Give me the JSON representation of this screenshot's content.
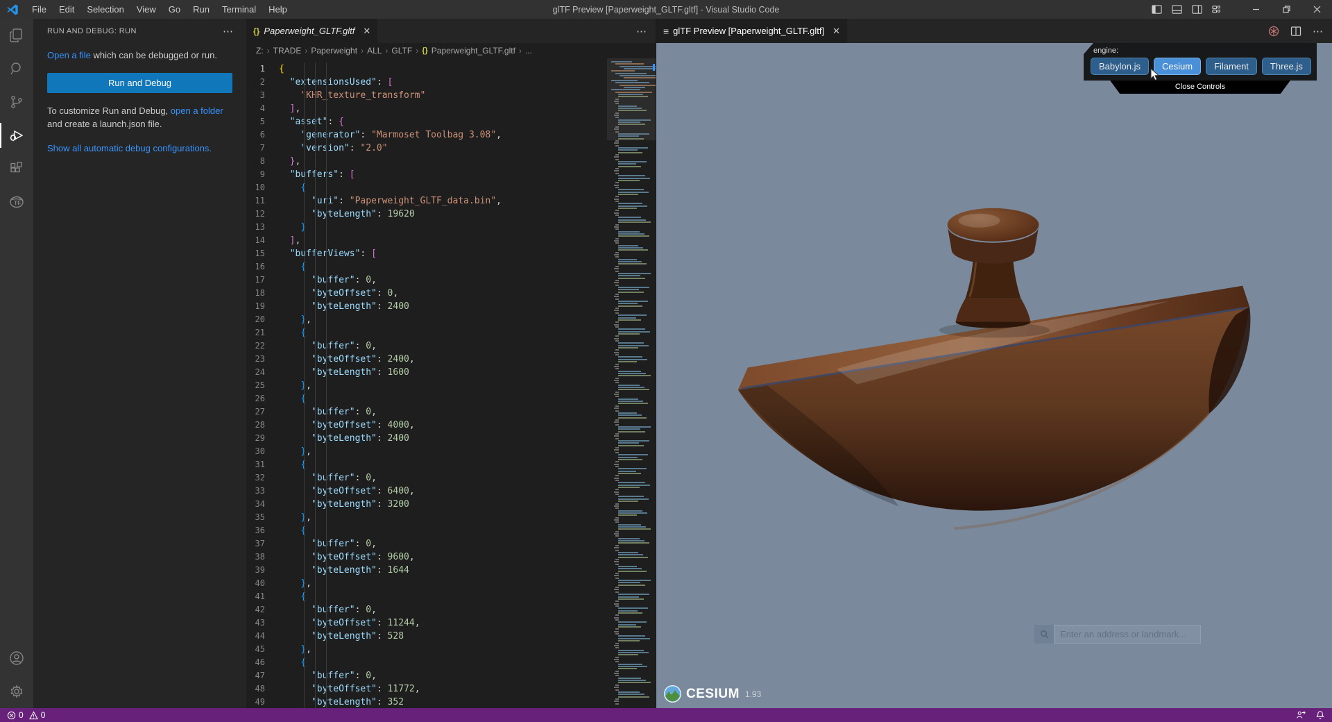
{
  "title_bar": {
    "title": "glTF Preview [Paperweight_GLTF.gltf] - Visual Studio Code",
    "menus": [
      "File",
      "Edit",
      "Selection",
      "View",
      "Go",
      "Run",
      "Terminal",
      "Help"
    ]
  },
  "activity_bar": {
    "items": [
      "explorer",
      "search",
      "source-control",
      "run-and-debug",
      "extensions",
      "gltf-tools"
    ],
    "active_item": "run-and-debug",
    "bottom_items": [
      "accounts",
      "settings"
    ]
  },
  "sidebar": {
    "header": "RUN AND DEBUG: RUN",
    "open_file": {
      "link": "Open a file",
      "rest": " which can be debugged or run."
    },
    "run_button": "Run and Debug",
    "customize": {
      "pre": "To customize Run and Debug, ",
      "link": "open a folder",
      "post": " and create a launch.json file."
    },
    "configs_link": "Show all automatic debug configurations."
  },
  "editor": {
    "tab_label": "Paperweight_GLTF.gltf",
    "breadcrumb": [
      "Z:",
      "TRADE",
      "Paperweight",
      "ALL",
      "GLTF",
      "Paperweight_GLTF.gltf",
      "..."
    ],
    "token_colors": {
      "k": "#9cdcfe",
      "s": "#ce9178",
      "n": "#b5cea8",
      "p": "#d4d4d4",
      "b1": "#ffd700",
      "b2": "#da70d6",
      "b3": "#179fff"
    },
    "lines": [
      [
        [
          "{",
          "b1"
        ]
      ],
      [
        [
          "  ",
          "p"
        ],
        [
          "\"extensionsUsed\"",
          "k"
        ],
        [
          ": ",
          "p"
        ],
        [
          "[",
          "b2"
        ]
      ],
      [
        [
          "    ",
          "p"
        ],
        [
          "\"KHR_texture_transform\"",
          "s"
        ]
      ],
      [
        [
          "  ",
          "p"
        ],
        [
          "]",
          "b2"
        ],
        [
          ",",
          "p"
        ]
      ],
      [
        [
          "  ",
          "p"
        ],
        [
          "\"asset\"",
          "k"
        ],
        [
          ": ",
          "p"
        ],
        [
          "{",
          "b2"
        ]
      ],
      [
        [
          "    ",
          "p"
        ],
        [
          "\"generator\"",
          "k"
        ],
        [
          ": ",
          "p"
        ],
        [
          "\"Marmoset Toolbag 3.08\"",
          "s"
        ],
        [
          ",",
          "p"
        ]
      ],
      [
        [
          "    ",
          "p"
        ],
        [
          "\"version\"",
          "k"
        ],
        [
          ": ",
          "p"
        ],
        [
          "\"2.0\"",
          "s"
        ]
      ],
      [
        [
          "  ",
          "p"
        ],
        [
          "}",
          "b2"
        ],
        [
          ",",
          "p"
        ]
      ],
      [
        [
          "  ",
          "p"
        ],
        [
          "\"buffers\"",
          "k"
        ],
        [
          ": ",
          "p"
        ],
        [
          "[",
          "b2"
        ]
      ],
      [
        [
          "    ",
          "p"
        ],
        [
          "{",
          "b3"
        ]
      ],
      [
        [
          "      ",
          "p"
        ],
        [
          "\"uri\"",
          "k"
        ],
        [
          ": ",
          "p"
        ],
        [
          "\"Paperweight_GLTF_data.bin\"",
          "s"
        ],
        [
          ",",
          "p"
        ]
      ],
      [
        [
          "      ",
          "p"
        ],
        [
          "\"byteLength\"",
          "k"
        ],
        [
          ": ",
          "p"
        ],
        [
          "19620",
          "n"
        ]
      ],
      [
        [
          "    ",
          "p"
        ],
        [
          "}",
          "b3"
        ]
      ],
      [
        [
          "  ",
          "p"
        ],
        [
          "]",
          "b2"
        ],
        [
          ",",
          "p"
        ]
      ],
      [
        [
          "  ",
          "p"
        ],
        [
          "\"bufferViews\"",
          "k"
        ],
        [
          ": ",
          "p"
        ],
        [
          "[",
          "b2"
        ]
      ],
      [
        [
          "    ",
          "p"
        ],
        [
          "{",
          "b3"
        ]
      ],
      [
        [
          "      ",
          "p"
        ],
        [
          "\"buffer\"",
          "k"
        ],
        [
          ": ",
          "p"
        ],
        [
          "0",
          "n"
        ],
        [
          ",",
          "p"
        ]
      ],
      [
        [
          "      ",
          "p"
        ],
        [
          "\"byteOffset\"",
          "k"
        ],
        [
          ": ",
          "p"
        ],
        [
          "0",
          "n"
        ],
        [
          ",",
          "p"
        ]
      ],
      [
        [
          "      ",
          "p"
        ],
        [
          "\"byteLength\"",
          "k"
        ],
        [
          ": ",
          "p"
        ],
        [
          "2400",
          "n"
        ]
      ],
      [
        [
          "    ",
          "p"
        ],
        [
          "}",
          "b3"
        ],
        [
          ",",
          "p"
        ]
      ],
      [
        [
          "    ",
          "p"
        ],
        [
          "{",
          "b3"
        ]
      ],
      [
        [
          "      ",
          "p"
        ],
        [
          "\"buffer\"",
          "k"
        ],
        [
          ": ",
          "p"
        ],
        [
          "0",
          "n"
        ],
        [
          ",",
          "p"
        ]
      ],
      [
        [
          "      ",
          "p"
        ],
        [
          "\"byteOffset\"",
          "k"
        ],
        [
          ": ",
          "p"
        ],
        [
          "2400",
          "n"
        ],
        [
          ",",
          "p"
        ]
      ],
      [
        [
          "      ",
          "p"
        ],
        [
          "\"byteLength\"",
          "k"
        ],
        [
          ": ",
          "p"
        ],
        [
          "1600",
          "n"
        ]
      ],
      [
        [
          "    ",
          "p"
        ],
        [
          "}",
          "b3"
        ],
        [
          ",",
          "p"
        ]
      ],
      [
        [
          "    ",
          "p"
        ],
        [
          "{",
          "b3"
        ]
      ],
      [
        [
          "      ",
          "p"
        ],
        [
          "\"buffer\"",
          "k"
        ],
        [
          ": ",
          "p"
        ],
        [
          "0",
          "n"
        ],
        [
          ",",
          "p"
        ]
      ],
      [
        [
          "      ",
          "p"
        ],
        [
          "\"byteOffset\"",
          "k"
        ],
        [
          ": ",
          "p"
        ],
        [
          "4000",
          "n"
        ],
        [
          ",",
          "p"
        ]
      ],
      [
        [
          "      ",
          "p"
        ],
        [
          "\"byteLength\"",
          "k"
        ],
        [
          ": ",
          "p"
        ],
        [
          "2400",
          "n"
        ]
      ],
      [
        [
          "    ",
          "p"
        ],
        [
          "}",
          "b3"
        ],
        [
          ",",
          "p"
        ]
      ],
      [
        [
          "    ",
          "p"
        ],
        [
          "{",
          "b3"
        ]
      ],
      [
        [
          "      ",
          "p"
        ],
        [
          "\"buffer\"",
          "k"
        ],
        [
          ": ",
          "p"
        ],
        [
          "0",
          "n"
        ],
        [
          ",",
          "p"
        ]
      ],
      [
        [
          "      ",
          "p"
        ],
        [
          "\"byteOffset\"",
          "k"
        ],
        [
          ": ",
          "p"
        ],
        [
          "6400",
          "n"
        ],
        [
          ",",
          "p"
        ]
      ],
      [
        [
          "      ",
          "p"
        ],
        [
          "\"byteLength\"",
          "k"
        ],
        [
          ": ",
          "p"
        ],
        [
          "3200",
          "n"
        ]
      ],
      [
        [
          "    ",
          "p"
        ],
        [
          "}",
          "b3"
        ],
        [
          ",",
          "p"
        ]
      ],
      [
        [
          "    ",
          "p"
        ],
        [
          "{",
          "b3"
        ]
      ],
      [
        [
          "      ",
          "p"
        ],
        [
          "\"buffer\"",
          "k"
        ],
        [
          ": ",
          "p"
        ],
        [
          "0",
          "n"
        ],
        [
          ",",
          "p"
        ]
      ],
      [
        [
          "      ",
          "p"
        ],
        [
          "\"byteOffset\"",
          "k"
        ],
        [
          ": ",
          "p"
        ],
        [
          "9600",
          "n"
        ],
        [
          ",",
          "p"
        ]
      ],
      [
        [
          "      ",
          "p"
        ],
        [
          "\"byteLength\"",
          "k"
        ],
        [
          ": ",
          "p"
        ],
        [
          "1644",
          "n"
        ]
      ],
      [
        [
          "    ",
          "p"
        ],
        [
          "}",
          "b3"
        ],
        [
          ",",
          "p"
        ]
      ],
      [
        [
          "    ",
          "p"
        ],
        [
          "{",
          "b3"
        ]
      ],
      [
        [
          "      ",
          "p"
        ],
        [
          "\"buffer\"",
          "k"
        ],
        [
          ": ",
          "p"
        ],
        [
          "0",
          "n"
        ],
        [
          ",",
          "p"
        ]
      ],
      [
        [
          "      ",
          "p"
        ],
        [
          "\"byteOffset\"",
          "k"
        ],
        [
          ": ",
          "p"
        ],
        [
          "11244",
          "n"
        ],
        [
          ",",
          "p"
        ]
      ],
      [
        [
          "      ",
          "p"
        ],
        [
          "\"byteLength\"",
          "k"
        ],
        [
          ": ",
          "p"
        ],
        [
          "528",
          "n"
        ]
      ],
      [
        [
          "    ",
          "p"
        ],
        [
          "}",
          "b3"
        ],
        [
          ",",
          "p"
        ]
      ],
      [
        [
          "    ",
          "p"
        ],
        [
          "{",
          "b3"
        ]
      ],
      [
        [
          "      ",
          "p"
        ],
        [
          "\"buffer\"",
          "k"
        ],
        [
          ": ",
          "p"
        ],
        [
          "0",
          "n"
        ],
        [
          ",",
          "p"
        ]
      ],
      [
        [
          "      ",
          "p"
        ],
        [
          "\"byteOffset\"",
          "k"
        ],
        [
          ": ",
          "p"
        ],
        [
          "11772",
          "n"
        ],
        [
          ",",
          "p"
        ]
      ],
      [
        [
          "      ",
          "p"
        ],
        [
          "\"byteLength\"",
          "k"
        ],
        [
          ": ",
          "p"
        ],
        [
          "352",
          "n"
        ]
      ]
    ]
  },
  "minimap": {
    "rows": 277
  },
  "preview": {
    "tab_label": "glTF Preview [Paperweight_GLTF.gltf]",
    "engine_label": "engine:",
    "engines": [
      "Babylon.js",
      "Cesium",
      "Filament",
      "Three.js"
    ],
    "selected_engine": "Cesium",
    "close_controls": "Close Controls",
    "geocoder_placeholder": "Enter an address or landmark...",
    "credit": {
      "brand": "CESIUM",
      "version": "1.93"
    }
  },
  "status_bar": {
    "errors": "0",
    "warnings": "0"
  },
  "colors": {
    "accent_button": "#1177bb",
    "link": "#3794ff",
    "status_bar": "#68217a",
    "engine_selected": "#4a90d9",
    "engine_unselected": "#2d5e8c",
    "preview_sky": "#7a8a9c",
    "json_icon": "#cbcb41"
  }
}
